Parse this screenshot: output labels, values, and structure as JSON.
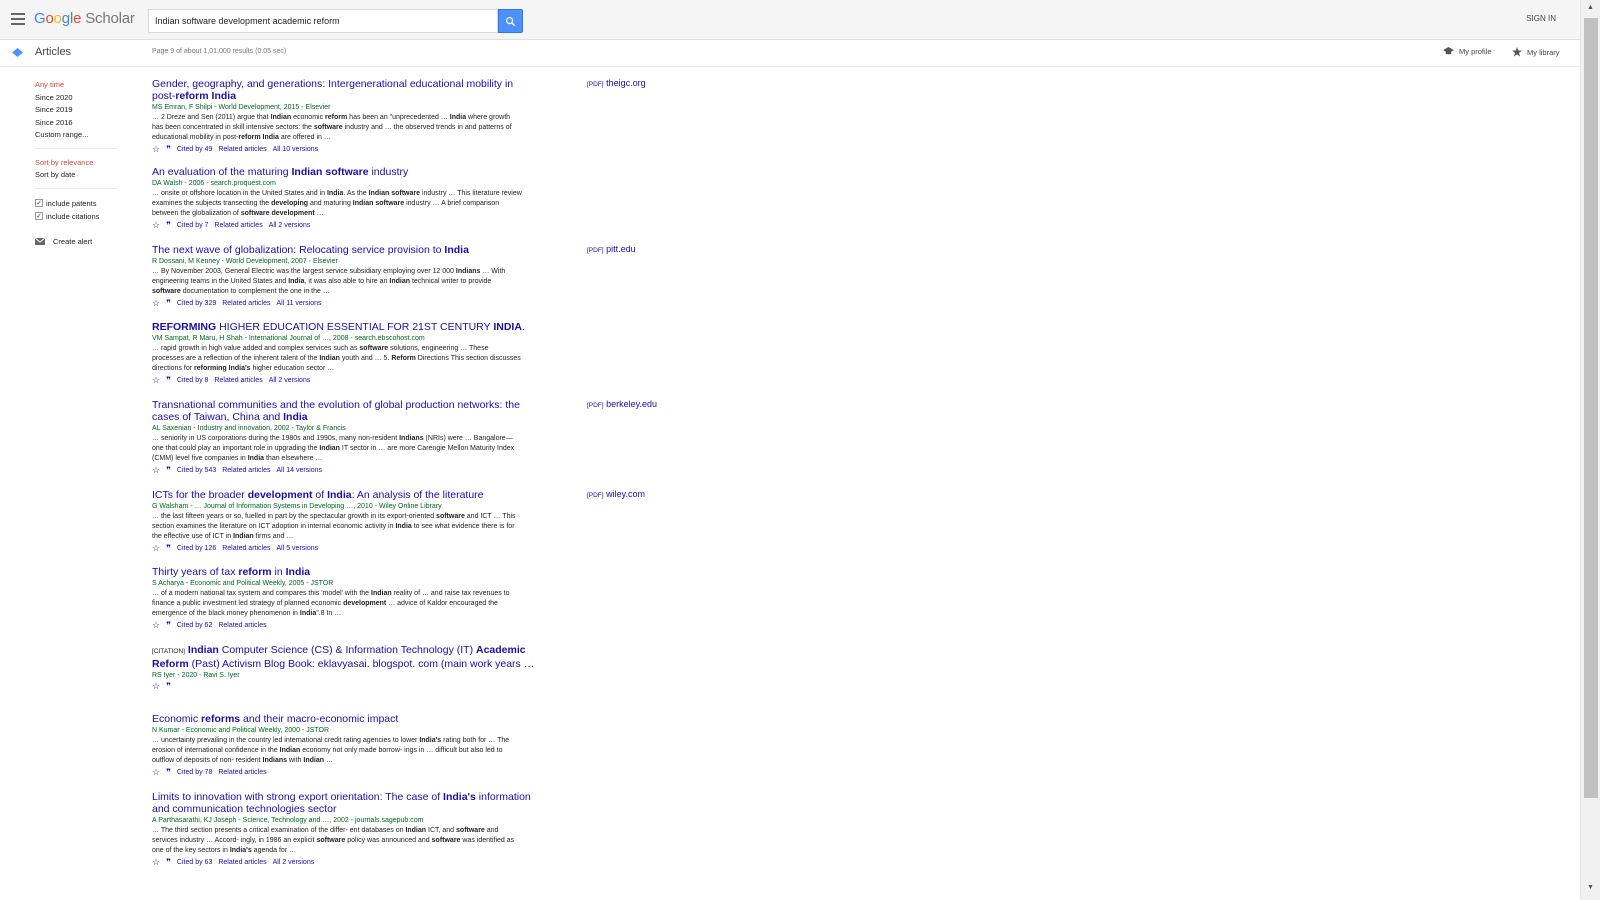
{
  "header": {
    "logo_letters": [
      "G",
      "o",
      "o",
      "g",
      "l",
      "e"
    ],
    "logo_product": "Scholar",
    "search_value": "Indian software development academic reform",
    "sign_in": "SIGN IN"
  },
  "subheader": {
    "section": "Articles",
    "stats": "Page 9 of about 1,01,000 results (0.05 sec)",
    "my_profile": "My profile",
    "my_library": "My library"
  },
  "sidebar": {
    "time_filters": [
      "Any time",
      "Since 2020",
      "Since 2019",
      "Since 2016",
      "Custom range..."
    ],
    "sort": [
      "Sort by relevance",
      "Sort by date"
    ],
    "checks": [
      "include patents",
      "include citations"
    ],
    "create_alert": "Create alert"
  },
  "results": [
    {
      "title": "Gender, geography, and generations: Intergenerational educational mobility in post-reform India",
      "meta": "MS Emran, F Shilpi - World Development, 2015 - Elsevier",
      "snippet": "… 2 Dreze and Sen (2011) argue that Indian economic reform has been an \"unprecedented … India where growth has been concentrated in skill intensive sectors: the software industry and … the observed trends in and patterns of educational mobility in post-reform India are offered in …",
      "cited": "Cited by 49",
      "related": "Related articles",
      "versions": "All 10 versions",
      "pdf_tag": "[PDF]",
      "pdf_site": "theigc.org"
    },
    {
      "title": "An evaluation of the maturing Indian software industry",
      "meta": "DA Walsh - 2006 - search.proquest.com",
      "snippet": "… onsite or offshore location in the United States and in India. As the Indian software industry … This literature review examines the subjects transecting the developing and maturing Indian software industry … A brief comparison between the globalization of software development …",
      "cited": "Cited by 7",
      "related": "Related articles",
      "versions": "All 2 versions"
    },
    {
      "title": "The next wave of globalization: Relocating service provision to India",
      "meta": "R Dossani, M Kenney - World Development, 2007 - Elsevier",
      "snippet": "… By November 2003, General Electric was the largest service subsidiary employing over 12 000 Indians … With engineering teams in the United States and India, it was also able to hire an Indian technical writer to provide software documentation to complement the one in the …",
      "cited": "Cited by 329",
      "related": "Related articles",
      "versions": "All 11 versions",
      "pdf_tag": "[PDF]",
      "pdf_site": "pitt.edu"
    },
    {
      "title": "REFORMING HIGHER EDUCATION ESSENTIAL FOR 21ST CENTURY INDIA.",
      "meta": "VM Sampat, R Maru, H Shah - International Journal of …, 2008 - search.ebscohost.com",
      "snippet": "… rapid growth in high value added and complex services such as software solutions, engineering … These processes are a reflection of the inherent talent of the Indian youth and … 5. Reform Directions This section discusses directions for reforming India's higher education sector …",
      "cited": "Cited by 8",
      "related": "Related articles",
      "versions": "All 2 versions"
    },
    {
      "title": "Transnational communities and the evolution of global production networks: the cases of Taiwan, China and India",
      "meta": "AL Saxenian - Industry and innovation, 2002 - Taylor & Francis",
      "snippet": "… seniority in US corporations during the 1980s and 1990s, many non-resident Indians (NRIs) were … Bangalore—one that could play an important role in upgrading the Indian IT sector in … are more Carengie Mellon Maturity Index (CMM) level five companies in India than elsewhere …",
      "cited": "Cited by 543",
      "related": "Related articles",
      "versions": "All 14 versions",
      "pdf_tag": "[PDF]",
      "pdf_site": "berkeley.edu"
    },
    {
      "title": "ICTs for the broader development of India: An analysis of the literature",
      "meta": "G Walsham - … Journal of Information Systems in Developing …, 2010 - Wiley Online Library",
      "snippet": "… the last fifteen years or so, fuelled in part by the spectacular growth in its export-oriented software and ICT … This section examines the literature on ICT adoption in internal economic activity in India to see what evidence there is for the effective use of ICT in Indian firms and …",
      "cited": "Cited by 126",
      "related": "Related articles",
      "versions": "All 5 versions",
      "pdf_tag": "[PDF]",
      "pdf_site": "wiley.com"
    },
    {
      "title": "Thirty years of tax reform in India",
      "meta": "S Acharya - Economic and Political Weekly, 2005 - JSTOR",
      "snippet": "… of a modern national tax system and compares this 'model' with the Indian reality of … and raise tax revenues to finance a public investment led strategy of planned economic development … advice of Kaldor encouraged the emergence of the black money phenomenon in India\".8 In …",
      "cited": "Cited by 62",
      "related": "Related articles",
      "versions": ""
    },
    {
      "citation_tag": "[CITATION]",
      "title": "Indian Computer Science (CS) & Information Technology (IT) Academic Reform (Past) Activism Blog Book: eklavyasai. blogspot. com (main work years …",
      "meta": "RS Iyer - 2020 - Ravi S. Iyer",
      "snippet": "",
      "cited": "",
      "related": "",
      "versions": ""
    },
    {
      "title": "Economic reforms and their macro-economic impact",
      "meta": "N Kumar - Economic and Political Weekly, 2000 - JSTOR",
      "snippet": "… uncertainty prevailing in the country led international credit rating agencies to lower India's rating both for … The erosion of international confidence in the Indian economy not only made borrow- ings in … difficult but also led to outflow of deposits of non- resident Indians with Indian …",
      "cited": "Cited by 78",
      "related": "Related articles",
      "versions": ""
    },
    {
      "title": "Limits to innovation with strong export orientation: The case of India's information and communication technologies sector",
      "meta": "A Parthasarathi, KJ Joseph - Science, Technology and …, 2002 - journals.sagepub.com",
      "snippet": "… The third section presents a critical examination of the differ- ent databases on Indian ICT, and software and services industry … Accord- ingly, in 1986 an explicit software policy was announced and software was identified as one of the key sectors in India's agenda for …",
      "cited": "Cited by 63",
      "related": "Related articles",
      "versions": "All 2 versions"
    }
  ],
  "colors": {
    "link": "#1a0dab",
    "meta_green": "#006621",
    "active_red": "#d14836",
    "search_blue": "#4d90fe"
  }
}
